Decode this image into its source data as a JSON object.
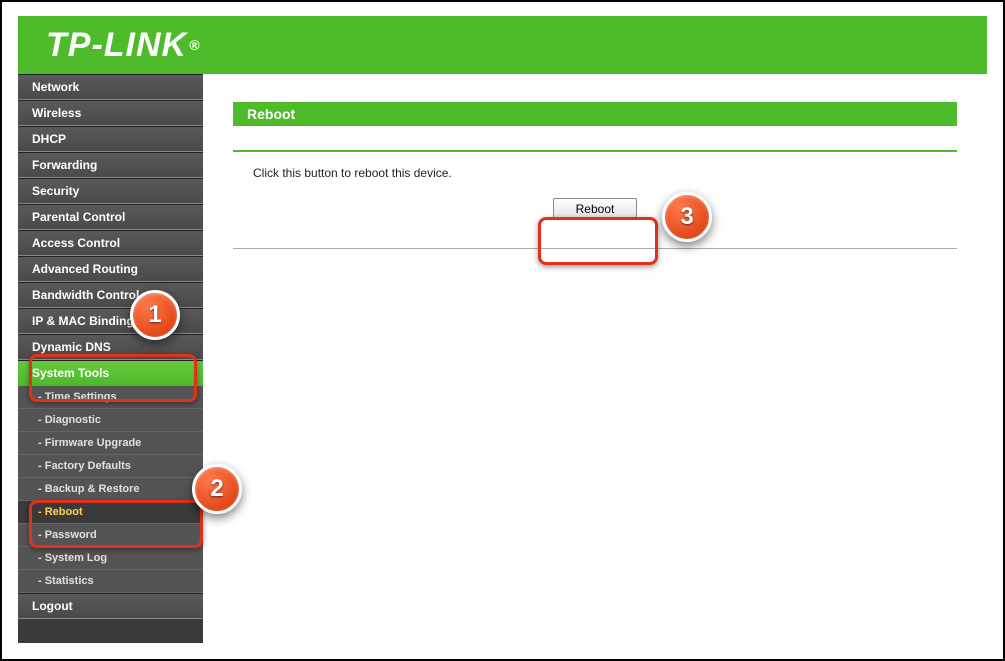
{
  "brand": "TP-LINK",
  "brand_reg": "®",
  "sidebar": {
    "items": [
      {
        "label": "Network",
        "kind": "top"
      },
      {
        "label": "Wireless",
        "kind": "top"
      },
      {
        "label": "DHCP",
        "kind": "top"
      },
      {
        "label": "Forwarding",
        "kind": "top"
      },
      {
        "label": "Security",
        "kind": "top"
      },
      {
        "label": "Parental Control",
        "kind": "top"
      },
      {
        "label": "Access Control",
        "kind": "top"
      },
      {
        "label": "Advanced Routing",
        "kind": "top"
      },
      {
        "label": "Bandwidth Control",
        "kind": "top"
      },
      {
        "label": "IP & MAC Binding",
        "kind": "top"
      },
      {
        "label": "Dynamic DNS",
        "kind": "top"
      },
      {
        "label": "System Tools",
        "kind": "top",
        "active": true
      },
      {
        "label": "- Time Settings",
        "kind": "sub"
      },
      {
        "label": "- Diagnostic",
        "kind": "sub"
      },
      {
        "label": "- Firmware Upgrade",
        "kind": "sub"
      },
      {
        "label": "- Factory Defaults",
        "kind": "sub"
      },
      {
        "label": "- Backup & Restore",
        "kind": "sub"
      },
      {
        "label": "- Reboot",
        "kind": "sub",
        "selected": true
      },
      {
        "label": "- Password",
        "kind": "sub"
      },
      {
        "label": "- System Log",
        "kind": "sub"
      },
      {
        "label": "- Statistics",
        "kind": "sub"
      },
      {
        "label": "Logout",
        "kind": "top"
      }
    ]
  },
  "page": {
    "title": "Reboot",
    "description": "Click this button to reboot this device.",
    "button_label": "Reboot"
  },
  "callouts": {
    "c1": "1",
    "c2": "2",
    "c3": "3"
  }
}
